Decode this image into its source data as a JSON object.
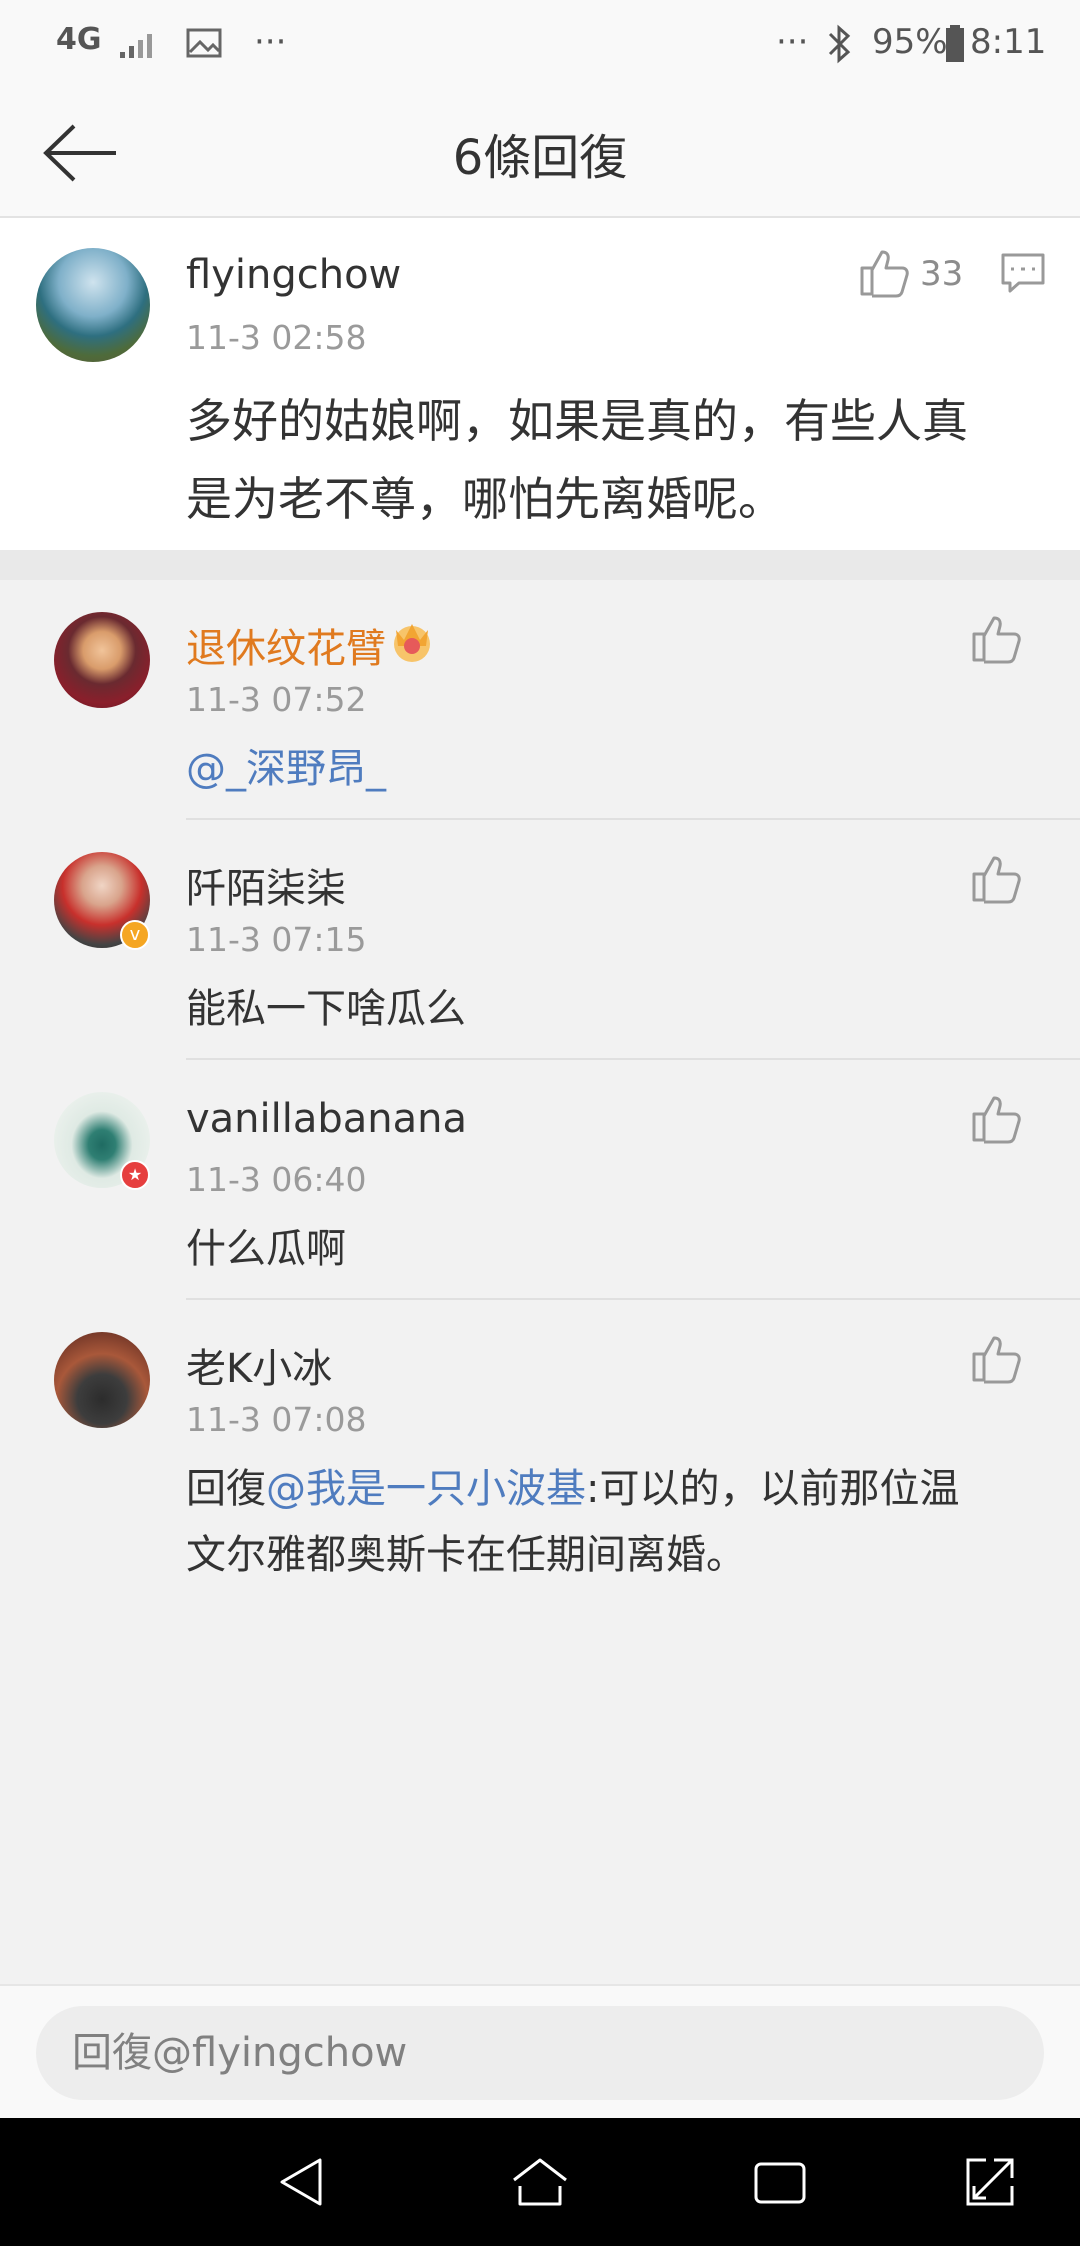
{
  "status_bar": {
    "network": "4G",
    "battery": "95%",
    "time": "8:11",
    "icons": [
      "signal-icon",
      "gallery-icon",
      "more-icon",
      "bluetooth-icon",
      "battery-icon"
    ]
  },
  "header": {
    "title": "6條回復",
    "back_icon": "back-arrow-icon"
  },
  "main_comment": {
    "username": "flyingchow",
    "time": "11-3 02:58",
    "like_count": "33",
    "text_line1": "多好的姑娘啊，如果是真的，有些人真",
    "text_line2": "是为老不尊，哪怕先离婚呢。"
  },
  "replies": [
    {
      "username": "退休纹花臂",
      "badge_icon": "crown-vip-icon",
      "time": "11-3 07:52",
      "text": "@_深野昂_",
      "username_color": "#e07a1f"
    },
    {
      "username": "阡陌柒柒",
      "time": "11-3 07:15",
      "text": "能私一下啥瓜么"
    },
    {
      "username": "vanillabanana",
      "time": "11-3 06:40",
      "text": "什么瓜啊"
    },
    {
      "username": "老K小冰",
      "time": "11-3 07:08",
      "prefix": "回復",
      "mention": "@我是一只小波基",
      "text_line1": ":可以的，以前那位温",
      "text_line2": "文尔雅都奥斯卡在任期间离婚。"
    }
  ],
  "input": {
    "placeholder": "回復@flyingchow"
  },
  "colors": {
    "link": "#4f7cbf",
    "vip_name": "#e07a1f",
    "time": "#9a9a9a"
  }
}
